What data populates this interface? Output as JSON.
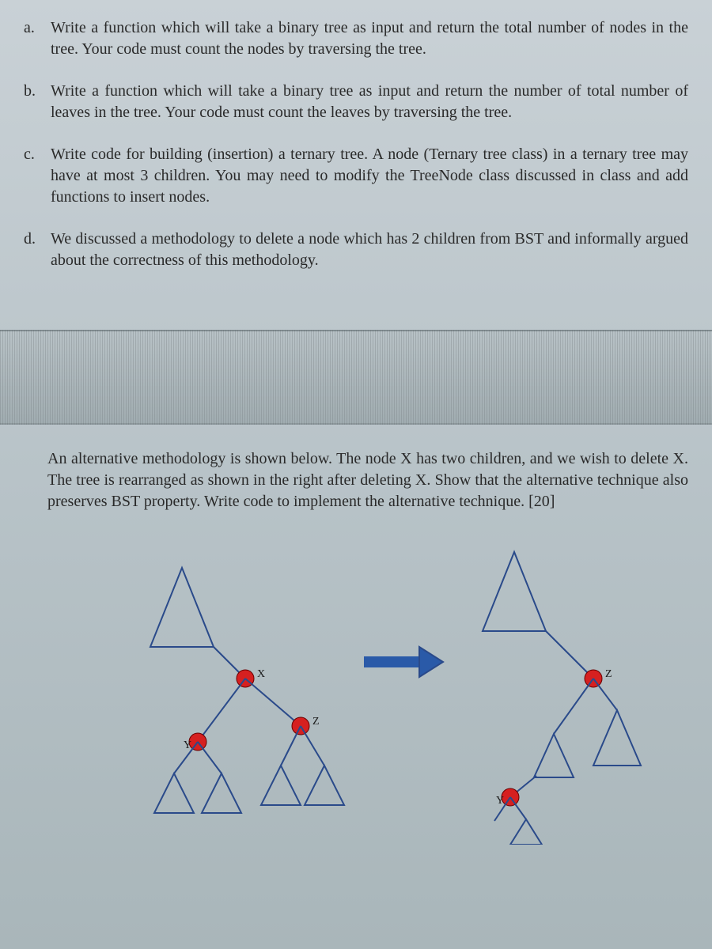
{
  "questions": [
    {
      "marker": "a.",
      "text": "Write a function which will take a binary tree as input and return the total number of nodes in the tree. Your code must count the nodes by traversing the tree."
    },
    {
      "marker": "b.",
      "text": "Write a function which will take a binary tree as input and return the number of total number of leaves in the tree. Your code must count the leaves by traversing the tree."
    },
    {
      "marker": "c.",
      "text": "Write code for building (insertion) a ternary tree. A node (Ternary tree class) in a ternary tree may have at most 3 children.  You may need to modify the TreeNode class discussed in class and add functions to insert nodes."
    },
    {
      "marker": "d.",
      "text": "We discussed a methodology to delete a node which has 2 children from BST and informally argued about the correctness of this methodology."
    }
  ],
  "section2_text": "An alternative methodology is shown below. The node X has two children, and we wish to delete X. The tree is rearranged as shown in the right after deleting X. Show that the alternative technique also preserves BST property. Write code to implement the alternative technique. [20]",
  "diagram_labels": {
    "left_x": "X",
    "left_y": "Y",
    "left_z": "Z",
    "right_z": "Z",
    "right_y": "Y"
  }
}
